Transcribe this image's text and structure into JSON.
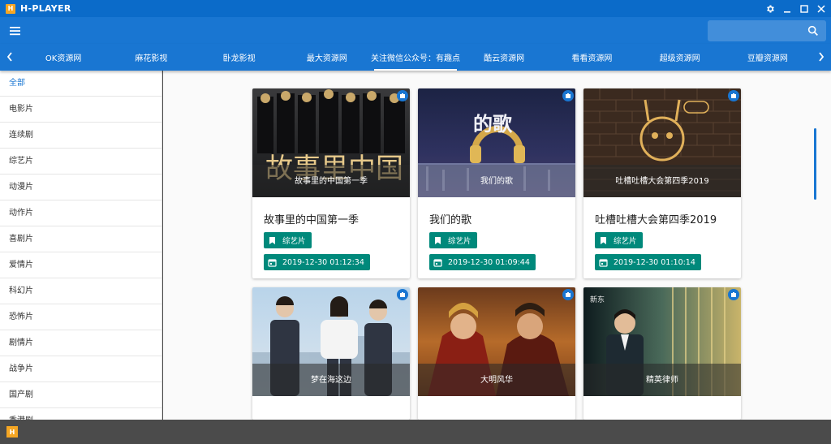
{
  "window": {
    "title": "H-PLAYER",
    "logo_letter": "H"
  },
  "appbar": {
    "search_placeholder": ""
  },
  "tabs": [
    {
      "label": "OK资源网"
    },
    {
      "label": "麻花影视"
    },
    {
      "label": "卧龙影视"
    },
    {
      "label": "最大资源网"
    },
    {
      "label": "关注微信公众号：有趣点",
      "active": true
    },
    {
      "label": "酷云资源网"
    },
    {
      "label": "看看资源网"
    },
    {
      "label": "超级资源网"
    },
    {
      "label": "豆瓣资源网"
    }
  ],
  "sidebar": {
    "items": [
      {
        "label": "全部",
        "active": true
      },
      {
        "label": "电影片"
      },
      {
        "label": "连续剧"
      },
      {
        "label": "综艺片"
      },
      {
        "label": "动漫片"
      },
      {
        "label": "动作片"
      },
      {
        "label": "喜剧片"
      },
      {
        "label": "爱情片"
      },
      {
        "label": "科幻片"
      },
      {
        "label": "恐怖片"
      },
      {
        "label": "剧情片"
      },
      {
        "label": "战争片"
      },
      {
        "label": "国产剧"
      },
      {
        "label": "香港剧"
      }
    ]
  },
  "cards": [
    {
      "caption": "故事里的中国第一季",
      "title": "故事里的中国第一季",
      "category": "综艺片",
      "date": "2019-12-30 01:12:34",
      "poster_icon": "movie-poster-icon"
    },
    {
      "caption": "我们的歌",
      "title": "我们的歌",
      "category": "综艺片",
      "date": "2019-12-30 01:09:44",
      "poster_icon": "movie-poster-icon"
    },
    {
      "caption": "吐槽吐槽大会第四季2019",
      "title": "吐槽吐槽大会第四季2019",
      "category": "综艺片",
      "date": "2019-12-30 01:10:14",
      "poster_icon": "movie-poster-icon"
    },
    {
      "caption": "梦在海这边",
      "poster_icon": "movie-poster-icon"
    },
    {
      "caption": "大明风华",
      "poster_icon": "movie-poster-icon"
    },
    {
      "caption": "精英律师",
      "poster_icon": "movie-poster-icon"
    }
  ],
  "colors": {
    "primary": "#1976d2",
    "titlebar": "#0b6bc9",
    "chip": "#00897b",
    "logo": "#f5a623"
  }
}
